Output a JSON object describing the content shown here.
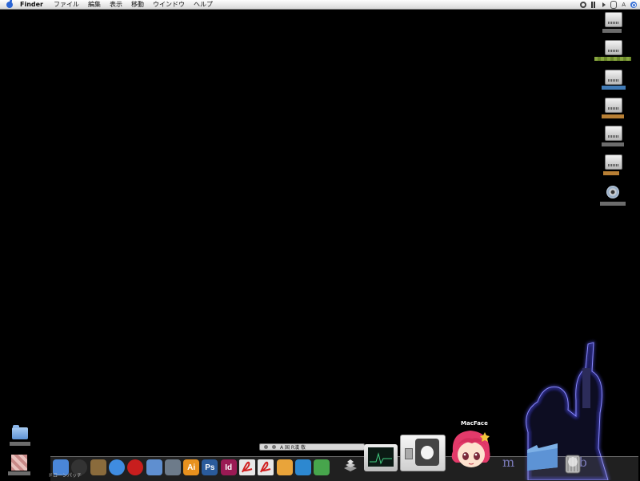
{
  "menubar": {
    "app_name": "Finder",
    "items": [
      "ファイル",
      "編集",
      "表示",
      "移動",
      "ウインドウ",
      "ヘルプ"
    ],
    "status_type": "A"
  },
  "desktop": {
    "disk_count": 6,
    "label_colors": [
      "#7f7f7f",
      "#9fc24a",
      "#4b8fd6",
      "#d8953d",
      "#7f7f7f",
      "#d8953d",
      "#7f7f7f"
    ]
  },
  "dock": {
    "apps": [
      {
        "name": "finder",
        "color": "#4a86d8"
      },
      {
        "name": "dashboard",
        "color": "#333"
      },
      {
        "name": "automator",
        "color": "#8a6b3c"
      },
      {
        "name": "safari",
        "color": "#3f8ce0"
      },
      {
        "name": "opera",
        "color": "#c81e1e"
      },
      {
        "name": "preview",
        "color": "#5f8fd0"
      },
      {
        "name": "script-editor",
        "color": "#6d7b8a"
      },
      {
        "name": "illustrator",
        "color": "#e8911e",
        "text": "Ai"
      },
      {
        "name": "photoshop",
        "color": "#2a5b9b",
        "text": "Ps"
      },
      {
        "name": "indesign",
        "color": "#9a1a54",
        "text": "Id"
      },
      {
        "name": "acrobat",
        "color": "#e7e7e7"
      },
      {
        "name": "acrobat-pro",
        "color": "#e7e7e7"
      },
      {
        "name": "sunflower",
        "color": "#e9a43a"
      },
      {
        "name": "dreamweaver-like",
        "color": "#2d88d0"
      },
      {
        "name": "network",
        "color": "#47a54c"
      }
    ],
    "dock_label": "ドロ一ンパッチ",
    "toolbar_text": "A 国 R漢 敬"
  },
  "widgets": {
    "macface_label": "MacFace"
  },
  "wallpaper": {
    "text": "m   u b"
  }
}
